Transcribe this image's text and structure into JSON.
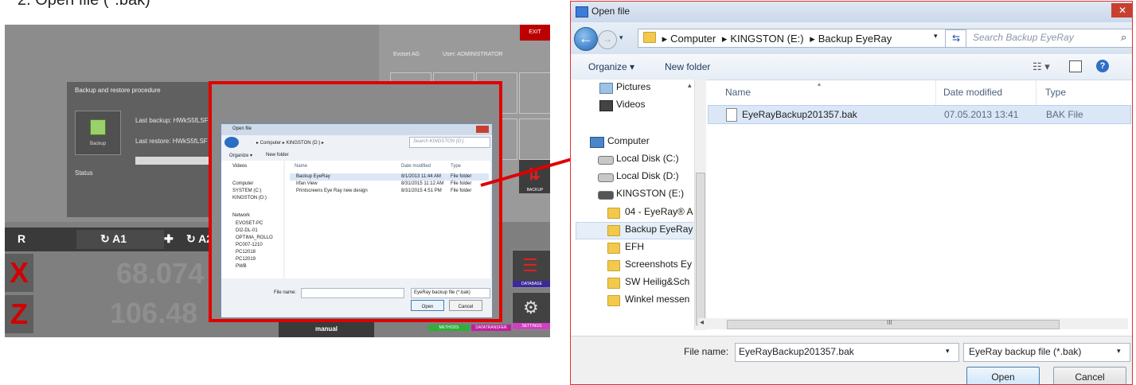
{
  "top_cutoff_text": "2. Open file (*.bak)",
  "app": {
    "exit_label": "EXIT",
    "header_company": "Evoset AG",
    "header_user": "User: ADMINISTRATOR",
    "backup_panel": {
      "title": "Backup and restore procedure",
      "backup_label": "Backup",
      "last_backup": "Last backup: HWkS5fLSF=",
      "last_restore": "Last restore: HWkS5fLSF =",
      "status_label": "Status"
    },
    "row": {
      "r": "R",
      "a1": "↻ A1",
      "plus": "✚",
      "a2": "↻ A2"
    },
    "axis_x": "X",
    "axis_z": "Z",
    "value_x": "68.074",
    "value_z": "106.48",
    "manual_label": "manual",
    "side_labels": {
      "backup": "BACKUP",
      "database": "DATABASE",
      "methods": "METHODS",
      "datatransfer": "DATATRANSFER",
      "settings": "SETTINGS"
    },
    "small_dialog": {
      "title": "Open file",
      "path": "▸ Computer ▸ KINGSTON (D:) ▸",
      "search": "Search KINGSTON (D:)",
      "organize": "Organize ▾",
      "new_folder": "New folder",
      "nav": [
        "Videos",
        "Computer",
        "SYSTEM (C:)",
        "KINGSTON (D:)",
        "Network",
        "EVOSET-PC",
        "DI2-DL-01",
        "OPTIMA_ROLLO",
        "PC007-1210",
        "PC12018",
        "PC12019",
        "PWB"
      ],
      "col_name": "Name",
      "col_date": "Date modified",
      "col_type": "Type",
      "rows": [
        {
          "name": "Backup EyeRay",
          "date": "8/1/2013 11:44 AM",
          "type": "File folder"
        },
        {
          "name": "Irfan View",
          "date": "8/31/2015 11:12 AM",
          "type": "File folder"
        },
        {
          "name": "Printscreens Eye Ray new design",
          "date": "8/31/2015 4:51 PM",
          "type": "File folder"
        }
      ],
      "file_name_label": "File name:",
      "file_type": "EyeRay backup file (*.bak)",
      "open": "Open",
      "cancel": "Cancel"
    }
  },
  "dialog": {
    "title": "Open file",
    "close": "✕",
    "breadcrumb": [
      "Computer",
      "KINGSTON (E:)",
      "Backup EyeRay"
    ],
    "search_placeholder": "Search Backup EyeRay",
    "organize": "Organize ▾",
    "new_folder": "New folder",
    "nav": {
      "pictures": "Pictures",
      "videos": "Videos",
      "computer": "Computer",
      "local_c": "Local Disk (C:)",
      "local_d": "Local Disk (D:)",
      "kingston": "KINGSTON (E:)",
      "f1": "04 - EyeRay® A",
      "f2": "Backup EyeRay",
      "f3": "EFH",
      "f4": "Screenshots Ey",
      "f5": "SW Heilig&Sch",
      "f6": "Winkel messen"
    },
    "columns": {
      "name": "Name",
      "date": "Date modified",
      "type": "Type"
    },
    "file": {
      "name": "EyeRayBackup201357.bak",
      "date": "07.05.2013 13:41",
      "type": "BAK File"
    },
    "scroll_grip": "III",
    "file_name_label": "File name:",
    "file_name_value": "EyeRayBackup201357.bak",
    "file_type": "EyeRay backup file (*.bak)",
    "open": "Open",
    "cancel": "Cancel"
  },
  "colors": {
    "highlight_red": "#e00000",
    "selection": "#dbe7f6"
  }
}
